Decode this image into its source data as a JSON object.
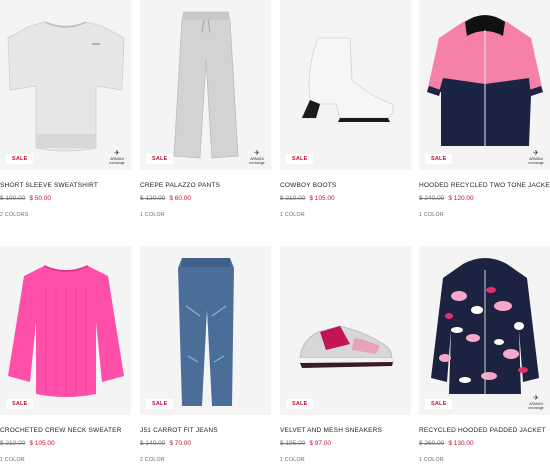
{
  "products": [
    {
      "name": "SHORT SLEEVE SWEATSHIRT",
      "old_price": "$ 100.00",
      "new_price": "$ 50.00",
      "colors": "2 COLORS",
      "badge": "SALE",
      "icon": "sweatshirt-icon",
      "brand": "ARMANI exchange"
    },
    {
      "name": "CREPE PALAZZO PANTS",
      "old_price": "$ 120.00",
      "new_price": "$ 60.00",
      "colors": "1 COLOR",
      "badge": "SALE",
      "icon": "pants-icon",
      "brand": "ARMANI exchange"
    },
    {
      "name": "COWBOY BOOTS",
      "old_price": "$ 210.00",
      "new_price": "$ 105.00",
      "colors": "1 COLOR",
      "badge": "SALE",
      "icon": "boot-icon"
    },
    {
      "name": "HOODED RECYCLED TWO TONE JACKET",
      "old_price": "$ 240.00",
      "new_price": "$ 120.00",
      "colors": "1 COLOR",
      "badge": "SALE",
      "icon": "jacket-icon",
      "brand": "ARMANI exchange"
    },
    {
      "name": "CROCHETED CREW NECK SWEATER",
      "old_price": "$ 210.00",
      "new_price": "$ 105.00",
      "colors": "1 COLOR",
      "badge": "SALE",
      "icon": "sweater-icon"
    },
    {
      "name": "J51 CARROT FIT JEANS",
      "old_price": "$ 140.00",
      "new_price": "$ 70.00",
      "colors": "2 COLOR",
      "badge": "SALE",
      "icon": "jeans-icon"
    },
    {
      "name": "VELVET AND MESH SNEAKERS",
      "old_price": "$ 195.00",
      "new_price": "$ 97.00",
      "colors": "1 COLOR",
      "badge": "SALE",
      "icon": "sneaker-icon"
    },
    {
      "name": "RECYCLED HOODED PADDED JACKET",
      "old_price": "$ 260.00",
      "new_price": "$ 130.00",
      "colors": "1 COLOR",
      "badge": "SALE",
      "icon": "padded-jacket-icon",
      "brand": "ARMANI exchange"
    }
  ]
}
